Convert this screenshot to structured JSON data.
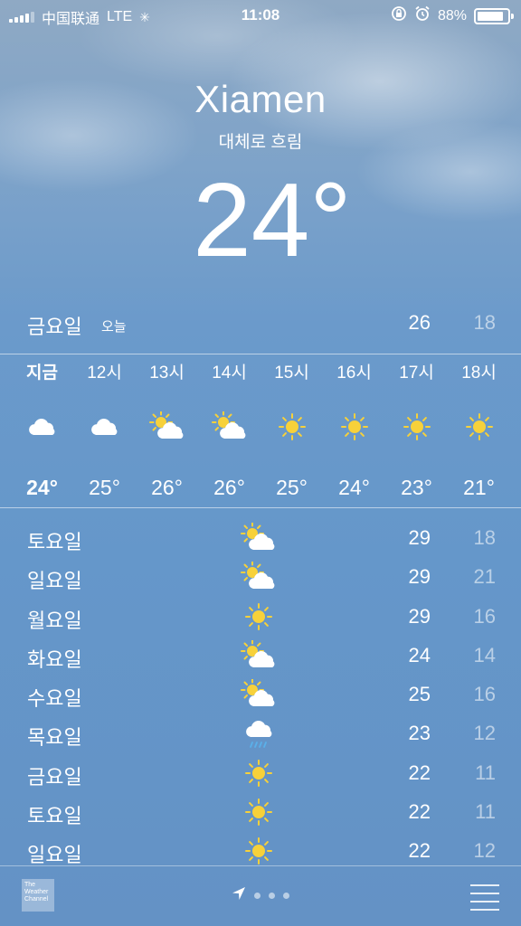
{
  "status_bar": {
    "carrier": "中国联通",
    "network": "LTE",
    "time": "11:08",
    "battery_percent": "88%",
    "battery_level": 0.88
  },
  "location": {
    "city": "Xiamen",
    "condition": "대체로 흐림",
    "temperature": "24°"
  },
  "today": {
    "day": "금요일",
    "tag": "오늘",
    "high": "26",
    "low": "18"
  },
  "hourly": [
    {
      "label": "지금",
      "icon": "cloud-icon",
      "temp": "24°"
    },
    {
      "label": "12시",
      "icon": "cloud-icon",
      "temp": "25°"
    },
    {
      "label": "13시",
      "icon": "partly-cloudy-icon",
      "temp": "26°"
    },
    {
      "label": "14시",
      "icon": "partly-cloudy-icon",
      "temp": "26°"
    },
    {
      "label": "15시",
      "icon": "sun-icon",
      "temp": "25°"
    },
    {
      "label": "16시",
      "icon": "sun-icon",
      "temp": "24°"
    },
    {
      "label": "17시",
      "icon": "sun-icon",
      "temp": "23°"
    },
    {
      "label": "18시",
      "icon": "sun-icon",
      "temp": "21°"
    }
  ],
  "daily": [
    {
      "day": "토요일",
      "icon": "partly-cloudy-icon",
      "high": "29",
      "low": "18"
    },
    {
      "day": "일요일",
      "icon": "partly-cloudy-icon",
      "high": "29",
      "low": "21"
    },
    {
      "day": "월요일",
      "icon": "sun-icon",
      "high": "29",
      "low": "16"
    },
    {
      "day": "화요일",
      "icon": "partly-cloudy-icon",
      "high": "24",
      "low": "14"
    },
    {
      "day": "수요일",
      "icon": "partly-cloudy-icon",
      "high": "25",
      "low": "16"
    },
    {
      "day": "목요일",
      "icon": "rain-cloud-icon",
      "high": "23",
      "low": "12"
    },
    {
      "day": "금요일",
      "icon": "sun-icon",
      "high": "22",
      "low": "11"
    },
    {
      "day": "토요일",
      "icon": "sun-icon",
      "high": "22",
      "low": "11"
    },
    {
      "day": "일요일",
      "icon": "sun-icon",
      "high": "22",
      "low": "12"
    }
  ],
  "footer": {
    "logo_text": "The Weather Channel"
  },
  "colors": {
    "sun": "#f7d13a",
    "text": "#ffffff"
  }
}
